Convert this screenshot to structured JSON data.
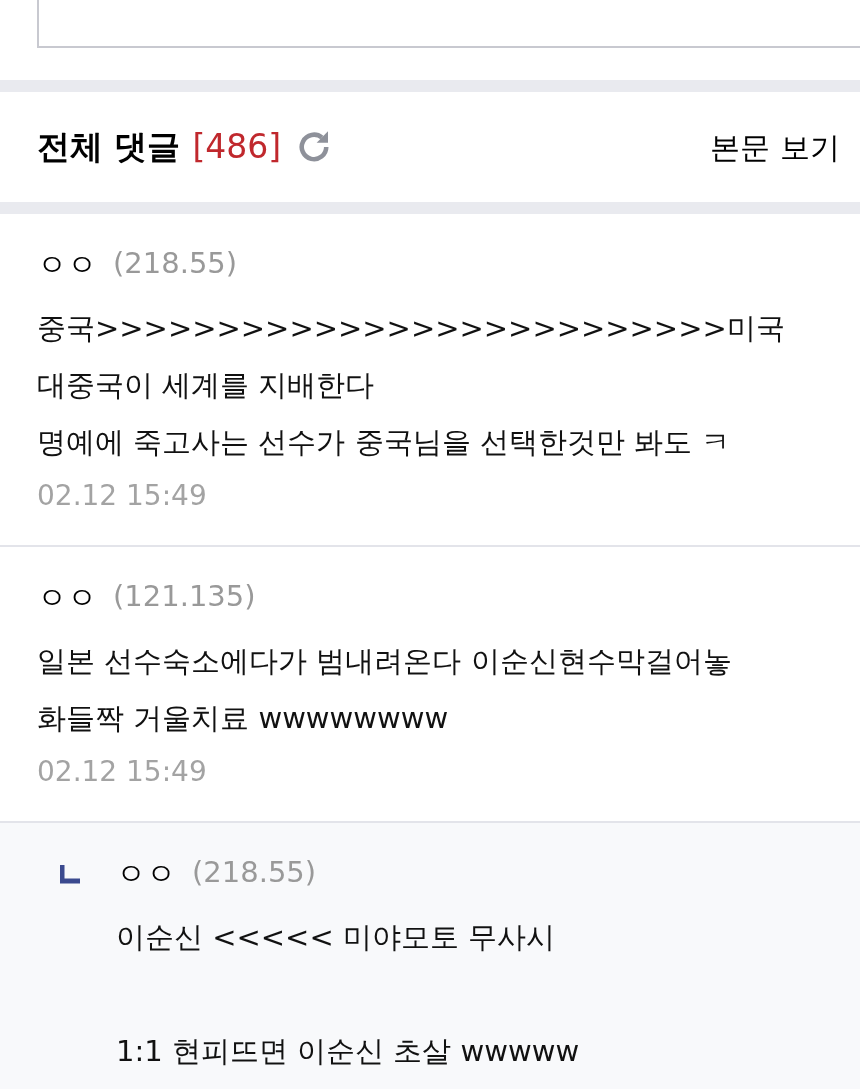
{
  "comments_header": {
    "title": "전체 댓글",
    "count": "[486]",
    "view_post": "본문 보기"
  },
  "comments": [
    {
      "kind": "comment",
      "author": "ㅇㅇ",
      "ip": "(218.55)",
      "paragraphs": [
        [
          "중국>>>>>>>>>>>>>>>>>>>>>>>>>>미국",
          "대중국이 세계를 지배한다",
          "명예에 죽고사는 선수가 중국님을 선택한것만 봐도 ㅋ"
        ]
      ],
      "time": "02.12 15:49"
    },
    {
      "kind": "comment",
      "author": "ㅇㅇ",
      "ip": "(121.135)",
      "paragraphs": [
        [
          "일본 선수숙소에다가 범내려온다 이순신현수막걸어놓",
          "화들짝 거울치료 wwwwwwww"
        ]
      ],
      "time": "02.12 15:49"
    },
    {
      "kind": "reply",
      "author": "ㅇㅇ",
      "ip": "(218.55)",
      "paragraphs": [
        [
          "이순신 <<<<< 미야모토 무사시"
        ],
        [
          "1:1 현피뜨면 이순신 초살 wwwww"
        ]
      ]
    }
  ]
}
